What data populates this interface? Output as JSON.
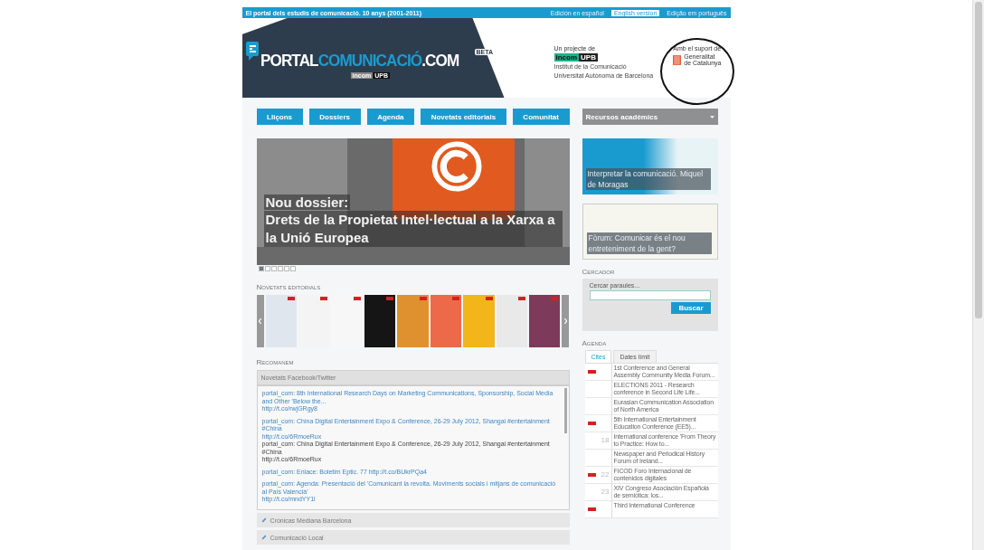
{
  "top_bar": {
    "tagline": "El portal dels estudis de comunicació. 10 anys (2001-2011)",
    "languages": [
      {
        "label": "Edición en español",
        "selected": false
      },
      {
        "label": "English version",
        "selected": true
      },
      {
        "label": "Edição em português",
        "selected": false
      }
    ]
  },
  "header": {
    "logo": {
      "part_1": "PORTAL",
      "part_2": "COMUNICACIÓ",
      "part_3": ".COM",
      "badge": "BETA",
      "sub_1": "incom",
      "sub_2": "UPB"
    },
    "project": {
      "label": "Un projecte de",
      "logo_1": "incom",
      "logo_2": "UPB",
      "line_1": "Institut de la Comunicació",
      "line_2": "Universitat Autònoma de Barcelona"
    },
    "support": {
      "label": "Amb el suport de",
      "name_1": "Generalitat",
      "name_2": "de Catalunya"
    }
  },
  "nav": {
    "items": [
      "Lliçons",
      "Dossiers",
      "Agenda",
      "Novetats editorials",
      "Comunitat"
    ],
    "dropdown": "Recursos acadèmics"
  },
  "hero": {
    "kicker": "Nou dossier:",
    "title": "Drets de la Propietat Intel·lectual a la Xarxa a la Unió Europea",
    "pager": [
      {
        "selected": true
      },
      {
        "selected": false
      },
      {
        "selected": false
      },
      {
        "selected": false
      },
      {
        "selected": false
      },
      {
        "selected": false
      }
    ]
  },
  "features": [
    {
      "caption": "Interpretar la comunicació. Miquel de Moragas",
      "kind": "teal"
    },
    {
      "caption": "Fòrum: Comunicar és el nou entreteniment de la gent?",
      "kind": "sketch"
    }
  ],
  "books": {
    "title": "Novetats editorials",
    "covers": [
      {
        "color": "#dfe6ee"
      },
      {
        "color": "#f4f4f4"
      },
      {
        "color": "#f7f7f7"
      },
      {
        "color": "#151515"
      },
      {
        "color": "#e0912f"
      },
      {
        "color": "#ec6a4a"
      },
      {
        "color": "#f2b51a"
      },
      {
        "color": "#e9e9e9"
      },
      {
        "color": "#7d3a5a"
      }
    ]
  },
  "search": {
    "title": "Cercador",
    "label": "Cercar paraules...",
    "button": "Buscar"
  },
  "recommend": {
    "title": "Recomanem",
    "panel": "Novetats Facebook/Twitter",
    "feed": [
      {
        "kind": "link",
        "text": "portal_com: 8th International Research Days on Marketing Communications, Sponsorship, Social Media and Other 'Below the...",
        "url": "http://t.co/rwjGRgy8"
      },
      {
        "kind": "link",
        "text": "portal_com: China Digital Entertainment Expo & Conference, 26-29 July 2012, Shangai #entertainment #China",
        "url": "http://t.co/6RmoeRux"
      },
      {
        "kind": "plain",
        "text": "portal_com: China Digital Entertainment Expo & Conference, 26-29 July 2012, Shangai #entertainment #China",
        "url": "http://t.co/6RmoeRux"
      },
      {
        "kind": "link",
        "text": "portal_com: Enlace: Boletim Eptic. 77 http://t.co/BUkrPQa4"
      },
      {
        "kind": "link",
        "text": "portal_com: Agenda: Presentació del 'Comunicant la revolta. Moviments socials i mitjans de comunicació al País Valencià'",
        "url": "http://t.co/mndYY1l"
      }
    ],
    "sections": [
      "Crònicas Mediana Barcelona",
      "Comunicació Local"
    ]
  },
  "agenda": {
    "title": "Agenda",
    "tabs": [
      {
        "label": "Cites",
        "selected": true
      },
      {
        "label": "Dates límit",
        "selected": false
      }
    ],
    "events": [
      {
        "flag": true,
        "text": "1st Conference and General Assembly Community Media Forum..."
      },
      {
        "flag": false,
        "text": "ELECTIONS 2011 - Research conference in Second Life Life..."
      },
      {
        "flag": false,
        "text": "Eurasian Communication Association of North America"
      },
      {
        "flag": true,
        "text": "5th International Entertainment Education Conference (EE5)..."
      },
      {
        "flag": false,
        "day": "18",
        "text": "International conference 'From Theory to Practice: How to..."
      },
      {
        "flag": false,
        "text": "Newspaper and Periodical History Forum of Ireland..."
      },
      {
        "flag": true,
        "day": "22",
        "text": "FICOD Foro Internacional de contenidos digitales"
      },
      {
        "flag": false,
        "day": "23",
        "text": "XIV Congreso Asociación Española de semiótica: los..."
      },
      {
        "flag": true,
        "text": "Third International Conference"
      }
    ]
  }
}
